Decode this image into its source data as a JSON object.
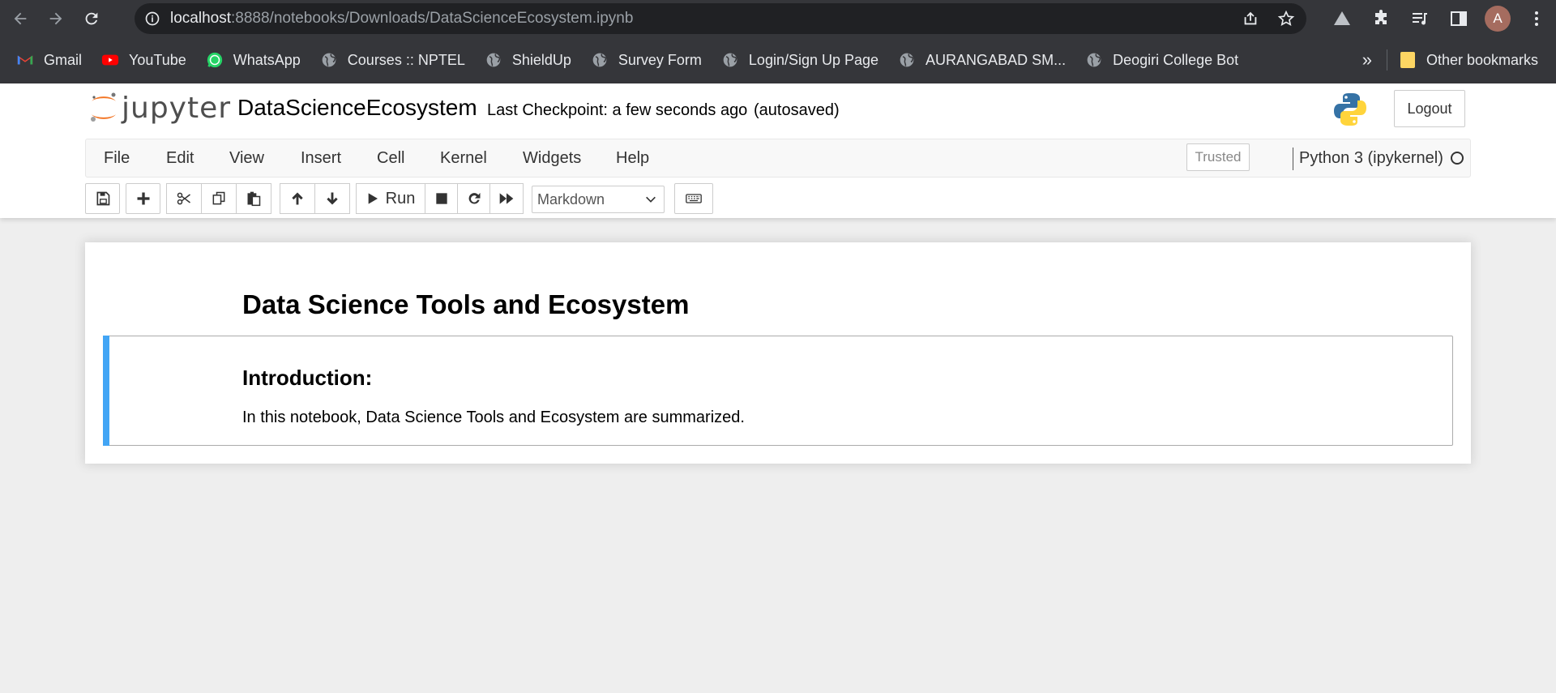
{
  "browser": {
    "url_host": "localhost",
    "url_rest": ":8888/notebooks/Downloads/DataScienceEcosystem.ipynb",
    "avatar_letter": "A"
  },
  "bookmarks": {
    "items": [
      {
        "label": "Gmail",
        "icon": "gmail-icon"
      },
      {
        "label": "YouTube",
        "icon": "youtube-icon"
      },
      {
        "label": "WhatsApp",
        "icon": "whatsapp-icon"
      },
      {
        "label": "Courses :: NPTEL",
        "icon": "globe-icon"
      },
      {
        "label": "ShieldUp",
        "icon": "globe-icon"
      },
      {
        "label": "Survey Form",
        "icon": "globe-icon"
      },
      {
        "label": "Login/Sign Up Page",
        "icon": "globe-icon"
      },
      {
        "label": "AURANGABAD SM...",
        "icon": "globe-icon"
      },
      {
        "label": "Deogiri College Bot",
        "icon": "globe-icon"
      }
    ],
    "more": "»",
    "other": "Other bookmarks"
  },
  "jupyter": {
    "logo_text": "jupyter",
    "notebook_title": "DataScienceEcosystem",
    "checkpoint": "Last Checkpoint: a few seconds ago",
    "autosaved": "(autosaved)",
    "logout": "Logout"
  },
  "menu": {
    "items": [
      "File",
      "Edit",
      "View",
      "Insert",
      "Cell",
      "Kernel",
      "Widgets",
      "Help"
    ],
    "trusted": "Trusted",
    "kernel": "Python 3 (ipykernel)"
  },
  "toolbar": {
    "run_label": "Run",
    "cell_type": "Markdown"
  },
  "notebook": {
    "heading": "Data Science Tools and Ecosystem",
    "cell_heading": "Introduction:",
    "cell_text": "In this notebook, Data Science Tools and Ecosystem are summarized."
  },
  "colors": {
    "chrome_bg": "#35363a",
    "omnibox_bg": "#202124",
    "cell_selected_bar": "#42a5f5",
    "jupyter_orange": "#f37626"
  }
}
